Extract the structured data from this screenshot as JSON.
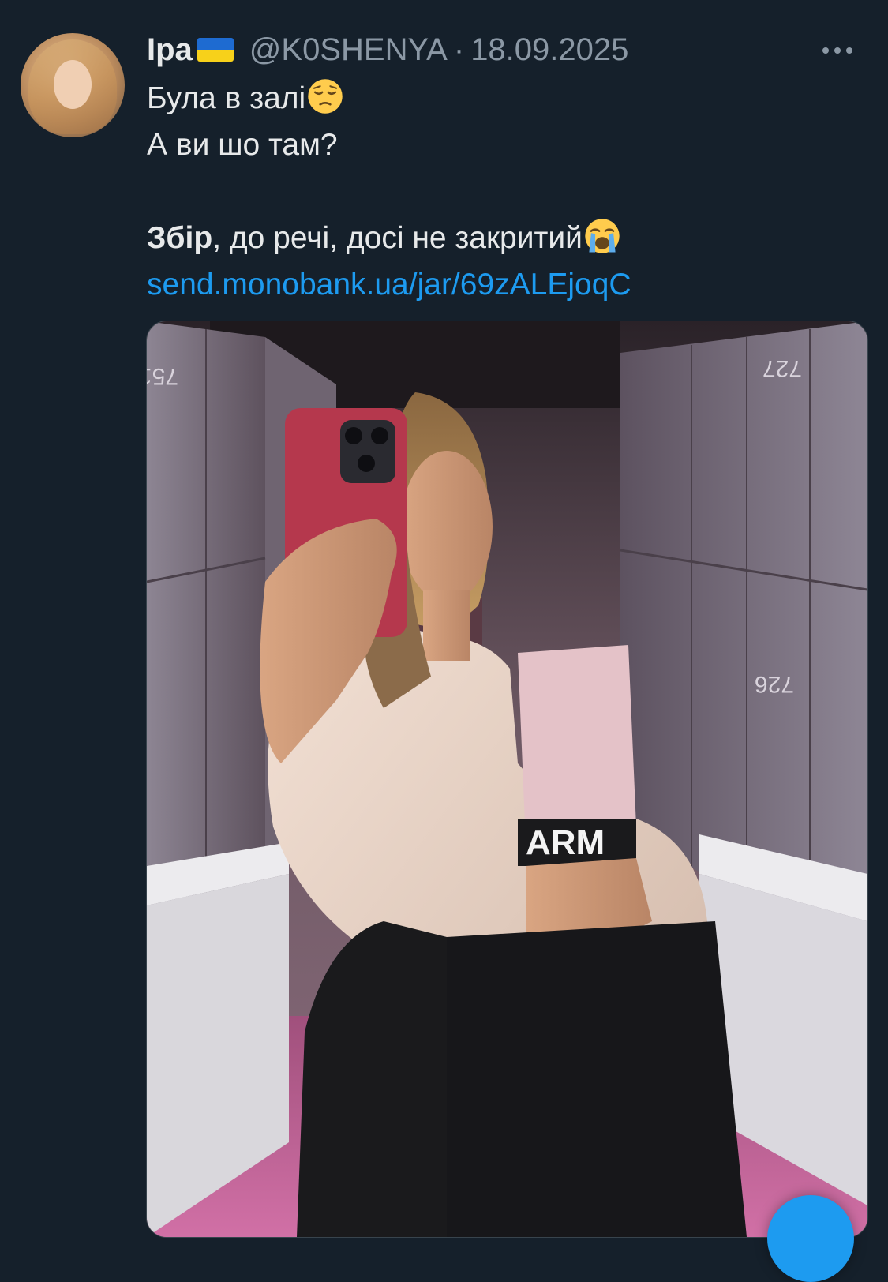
{
  "tweet": {
    "author": {
      "display_name": "Іра",
      "flag_icon": "ukraine-flag-icon",
      "handle": "@K0SHENYA",
      "separator": "·",
      "date": "18.09.2025"
    },
    "text": {
      "line1": "Була в залі",
      "line1_emoji": "pensive-face-emoji",
      "line2": "А ви шо там?",
      "line3_bold": "Збір",
      "line3_rest": ", до речі, досі не закритий",
      "line3_emoji": "loudly-crying-face-emoji",
      "link": "send.monobank.ua/jar/69zALEjoqC"
    },
    "media": {
      "type": "photo",
      "description_icon": "gym-locker-room-selfie-photo",
      "bra_text": "ARM"
    },
    "more_icon": "more-horizontal-icon",
    "compose_icon": "compose-fab-icon"
  },
  "colors": {
    "background": "#15202b",
    "primary_text": "#e7e9ea",
    "secondary_text": "#8b98a5",
    "link": "#1d9bf0"
  }
}
